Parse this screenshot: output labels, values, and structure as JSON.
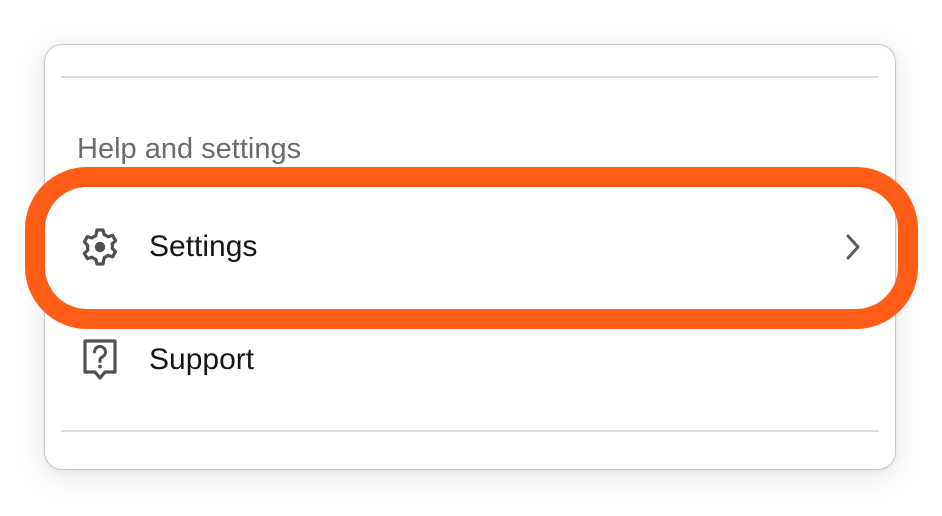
{
  "section": {
    "heading": "Help and settings"
  },
  "items": [
    {
      "label": "Settings",
      "icon": "gear-icon",
      "has_chevron": true,
      "highlighted": true
    },
    {
      "label": "Support",
      "icon": "help-bubble-icon",
      "has_chevron": false,
      "highlighted": false
    }
  ],
  "colors": {
    "highlight": "#ff5d17",
    "heading_text": "#6b6b6b",
    "label_text": "#151515",
    "icon": "#505050"
  }
}
